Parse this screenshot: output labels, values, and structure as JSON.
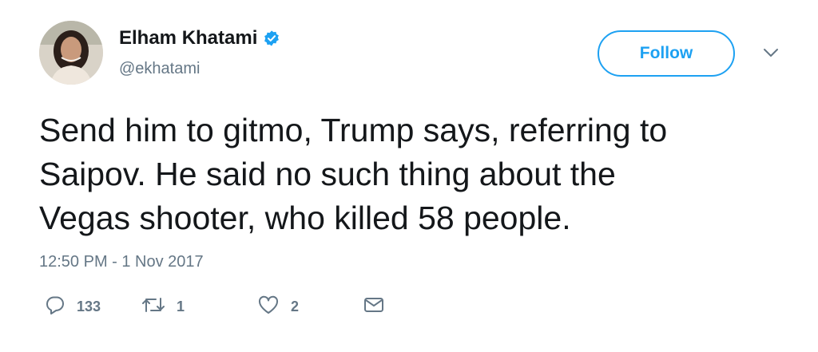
{
  "user": {
    "name": "Elham Khatami",
    "handle": "@ekhatami",
    "verified_icon": "verified-badge-icon",
    "avatar_icon": "profile-photo"
  },
  "follow_button": {
    "label": "Follow"
  },
  "menu": {
    "icon": "chevron-down-icon"
  },
  "tweet": {
    "lines": [
      "Send him to gitmo, Trump says, referring to",
      "Saipov. He said no such thing about the",
      "Vegas shooter, who killed 58 people."
    ],
    "timestamp": "12:50 PM - 1 Nov 2017"
  },
  "actions": {
    "reply": {
      "icon": "reply-icon",
      "count": "133"
    },
    "retweet": {
      "icon": "retweet-icon",
      "count": "1"
    },
    "like": {
      "icon": "heart-icon",
      "count": "2"
    },
    "message": {
      "icon": "envelope-icon"
    }
  },
  "colors": {
    "accent": "#1da1f2",
    "text": "#14171a",
    "secondary": "#657786"
  }
}
